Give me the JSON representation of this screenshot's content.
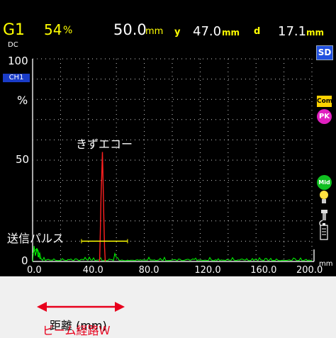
{
  "header": {
    "gate": "G1",
    "gain_value": "54",
    "gain_unit": "%",
    "range_value": "50.0",
    "range_unit": "mm",
    "y_label": "y",
    "y_value": "47.0",
    "y_unit": "mm",
    "d_label": "d",
    "d_value": "17.1",
    "d_unit": "mm"
  },
  "status": {
    "dc": "DC",
    "channel": "CH1",
    "sd": "SD",
    "com": "Com",
    "pk": "PK",
    "mid": "Mid"
  },
  "axes": {
    "y_max": "100",
    "y_unit": "%",
    "y_mid": "50",
    "y_min": "0",
    "x_unit": "mm",
    "x_ticks": [
      "0.0",
      "40.0",
      "80.0",
      "120.0",
      "160.0",
      "200.0"
    ]
  },
  "annotations": {
    "flaw_echo": "きずエコー",
    "transmit_pulse": "送信パルス"
  },
  "below": {
    "distance_label": "距離 (mm)",
    "beam_path_label": "ビーム経路Ｗ"
  },
  "colors": {
    "grid": "#cccccc",
    "signal": "#00ff00",
    "flaw": "#ff2020",
    "gate": "#ffff00",
    "accent_red": "#e8001c"
  },
  "chart_data": {
    "type": "line",
    "x_range": [
      0,
      200
    ],
    "y_range": [
      0,
      100
    ],
    "gate": {
      "start": 35,
      "end": 68,
      "level": 10
    },
    "flaw_echo_peak": {
      "x": 50,
      "y": 54
    }
  }
}
